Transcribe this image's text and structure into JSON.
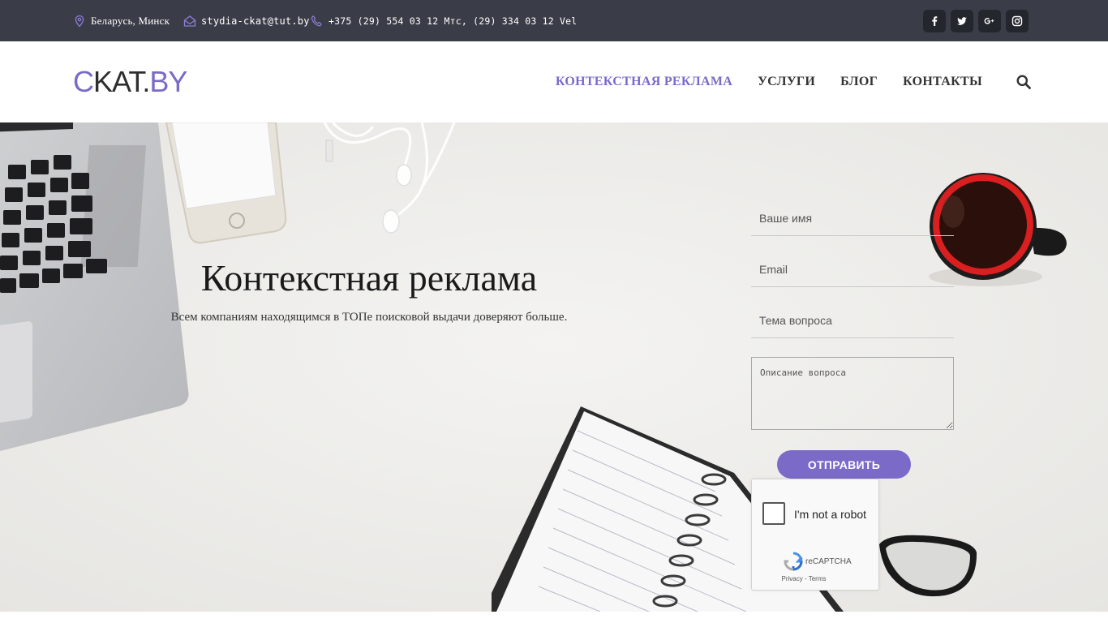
{
  "topbar": {
    "location": "Беларусь, Минск",
    "email": "stydia-ckat@tut.by",
    "phone": "+375 (29) 554 03 12 Мтс, (29) 334 03 12 Vel",
    "socials": [
      {
        "name": "facebook",
        "glyph": "f"
      },
      {
        "name": "twitter",
        "glyph": "t"
      },
      {
        "name": "google-plus",
        "glyph": "G+"
      },
      {
        "name": "instagram",
        "glyph": "ig"
      }
    ]
  },
  "header": {
    "logo": {
      "part1": "C",
      "part2": "KAT.",
      "part3": "BY"
    },
    "nav": [
      {
        "label": "КОНТЕКСТНАЯ РЕКЛАМА",
        "active": true
      },
      {
        "label": "УСЛУГИ",
        "active": false
      },
      {
        "label": "БЛОГ",
        "active": false
      },
      {
        "label": "КОНТАКТЫ",
        "active": false
      }
    ],
    "search_icon": "search-icon"
  },
  "hero": {
    "title": "Контекстная реклама",
    "subtitle": "Всем компаниям находящимся в ТОПе поисковой выдачи доверяют больше."
  },
  "form": {
    "name_placeholder": "Ваше имя",
    "email_placeholder": "Email",
    "topic_placeholder": "Тема вопроса",
    "description_placeholder": "Описание вопроса",
    "submit_label": "ОТПРАВИТЬ"
  },
  "recaptcha": {
    "label": "I'm not a robot",
    "brand": "reCAPTCHA",
    "privacy": "Privacy",
    "separator": " - ",
    "terms": "Terms"
  },
  "colors": {
    "accent": "#7b6ac7",
    "topbar": "#3a3d47",
    "text": "#333333"
  }
}
